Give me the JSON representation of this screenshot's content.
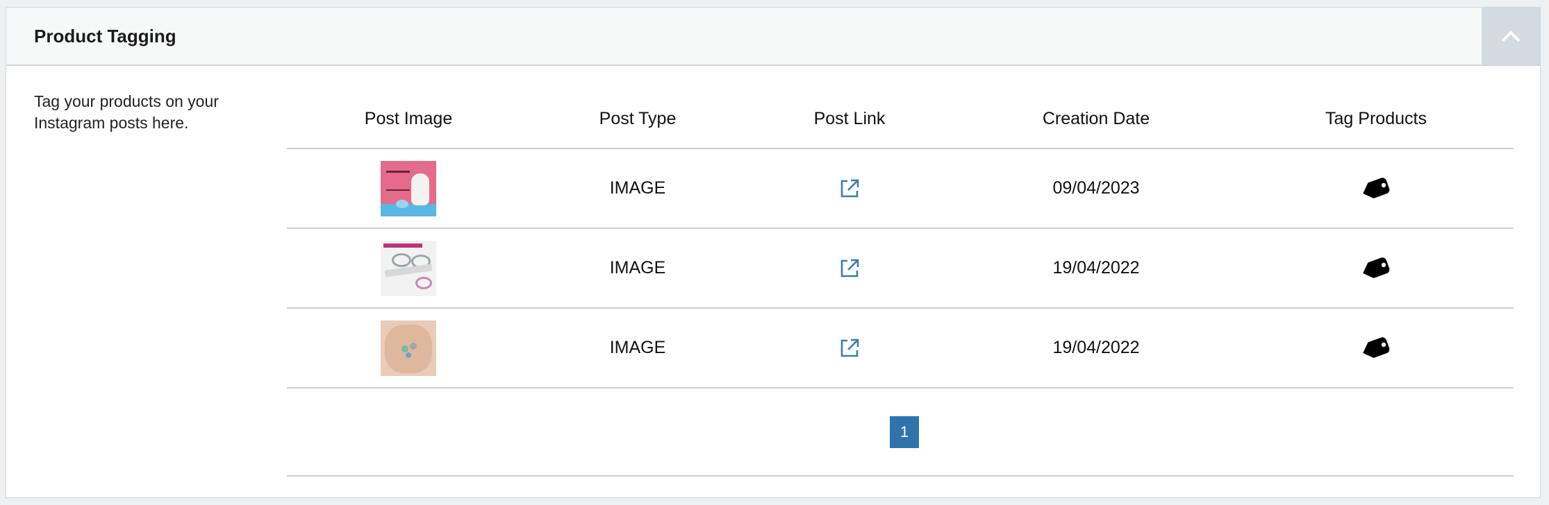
{
  "panel": {
    "title": "Product Tagging",
    "collapse_icon": "chevron-up-icon"
  },
  "description": "Tag your products on your Instagram posts here.",
  "table": {
    "headers": [
      "Post Image",
      "Post Type",
      "Post Link",
      "Creation Date",
      "Tag Products"
    ],
    "rows": [
      {
        "image": "easter-bunny-post-thumbnail",
        "type": "IMAGE",
        "link_icon": "external-link-icon",
        "date": "09/04/2023",
        "tag_icon": "tag-icon"
      },
      {
        "image": "rings-post-thumbnail",
        "type": "IMAGE",
        "link_icon": "external-link-icon",
        "date": "19/04/2022",
        "tag_icon": "tag-icon"
      },
      {
        "image": "jewelry-in-hand-thumbnail",
        "type": "IMAGE",
        "link_icon": "external-link-icon",
        "date": "19/04/2022",
        "tag_icon": "tag-icon"
      }
    ]
  },
  "pagination": {
    "current_page": "1"
  },
  "colors": {
    "accent": "#2f73ad",
    "link_icon": "#3a7bb3",
    "header_bg": "#f7f8f8",
    "collapse_bg": "#d3dbe0"
  }
}
